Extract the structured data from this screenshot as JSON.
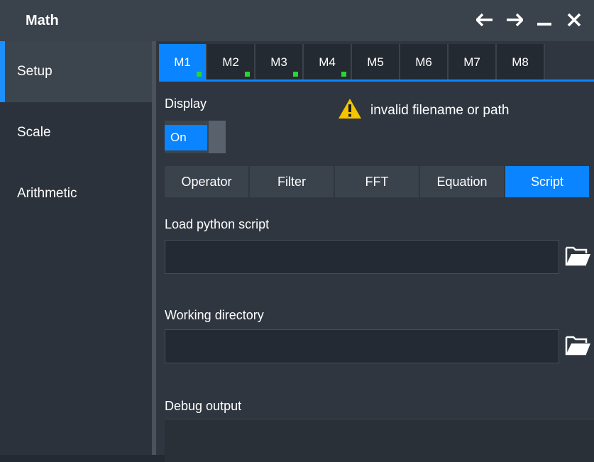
{
  "window": {
    "title": "Math",
    "icons": [
      "arrow-left-icon",
      "arrow-right-icon",
      "minimize-icon",
      "close-icon"
    ]
  },
  "sidebar": {
    "items": [
      {
        "label": "Setup",
        "active": true
      },
      {
        "label": "Scale",
        "active": false
      },
      {
        "label": "Arithmetic",
        "active": false
      }
    ]
  },
  "math_tabs": [
    {
      "label": "M1",
      "active": true,
      "indicator": true
    },
    {
      "label": "M2",
      "active": false,
      "indicator": true
    },
    {
      "label": "M3",
      "active": false,
      "indicator": true
    },
    {
      "label": "M4",
      "active": false,
      "indicator": true
    },
    {
      "label": "M5",
      "active": false,
      "indicator": false
    },
    {
      "label": "M6",
      "active": false,
      "indicator": false
    },
    {
      "label": "M7",
      "active": false,
      "indicator": false
    },
    {
      "label": "M8",
      "active": false,
      "indicator": false
    }
  ],
  "display": {
    "label": "Display",
    "toggle_value": "On"
  },
  "warning": {
    "icon": "warning-icon",
    "text": "invalid filename or path"
  },
  "mode_tabs": [
    {
      "label": "Operator",
      "active": false
    },
    {
      "label": "Filter",
      "active": false
    },
    {
      "label": "FFT",
      "active": false
    },
    {
      "label": "Equation",
      "active": false
    },
    {
      "label": "Script",
      "active": true
    }
  ],
  "script": {
    "load_label": "Load python script",
    "load_value": "",
    "workdir_label": "Working directory",
    "workdir_value": "",
    "debug_label": "Debug output"
  },
  "colors": {
    "accent": "#0a84ff",
    "indicator": "#28d630",
    "warning": "#f5c400"
  }
}
